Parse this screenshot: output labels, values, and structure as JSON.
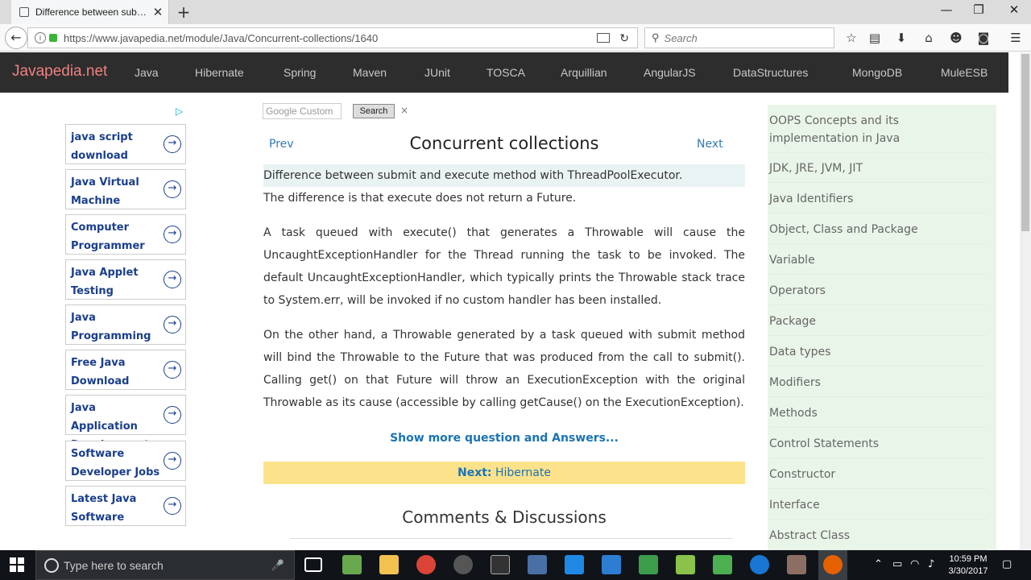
{
  "browser": {
    "tab_title": "Difference between submi...",
    "new_tab": "+",
    "url": "https://www.javapedia.net/module/Java/Concurrent-collections/1640",
    "search_placeholder": "Search"
  },
  "site": {
    "brand": "Javapedia.net",
    "menu": [
      "Java",
      "Hibernate",
      "Spring",
      "Maven",
      "JUnit",
      "TOSCA",
      "Arquillian",
      "AngularJS",
      "DataStructures",
      "MongoDB",
      "MuleESB"
    ]
  },
  "ads": [
    "java script download",
    "Java Virtual Machine",
    "Computer Programmer",
    "Java Applet Testing",
    "Java Programming",
    "Free Java Download",
    "Java Application Development",
    "Software Developer Jobs",
    "Latest Java Software"
  ],
  "gsearch": {
    "placeholder": "Google  Custom",
    "button": "Search",
    "clear": "×"
  },
  "main": {
    "prev": "Prev",
    "next": "Next",
    "title": "Concurrent collections",
    "question": "Difference between submit and execute method with ThreadPoolExecutor.",
    "answer_intro": "The difference is that execute does not return a Future.",
    "para1": "A task queued with execute() that generates a Throwable will cause the UncaughtExceptionHandler for the Thread running the task to be invoked. The default UncaughtExceptionHandler, which typically prints the Throwable stack trace to System.err, will be invoked if no custom handler has been installed.",
    "para2": "On the other hand, a Throwable generated by a task queued with submit method will bind the Throwable to the Future that was produced from the call to submit(). Calling get() on that Future will throw an ExecutionException with the original Throwable as its cause (accessible by calling getCause() on the ExecutionException).",
    "show_more": "Show more question and Answers...",
    "next_label": "Next:",
    "next_target": "Hibernate",
    "comments": "Comments & Discussions"
  },
  "sidebar": [
    "OOPS Concepts and its implementation in Java",
    "JDK, JRE, JVM, JIT",
    "Java Identifiers",
    "Object, Class and Package",
    "Variable",
    "Operators",
    "Package",
    "Data types",
    "Modifiers",
    "Methods",
    "Control Statements",
    "Constructor",
    "Interface",
    "Abstract Class"
  ],
  "taskbar": {
    "search_placeholder": "Type here to search",
    "time": "10:59 PM",
    "date": "3/30/2017"
  },
  "colors": {
    "brand": "#f08080",
    "header_bg": "#2d2d2d",
    "link": "#337ab7",
    "next_bar": "#fce28a",
    "sidebar_bg": "#eaf5ea"
  }
}
